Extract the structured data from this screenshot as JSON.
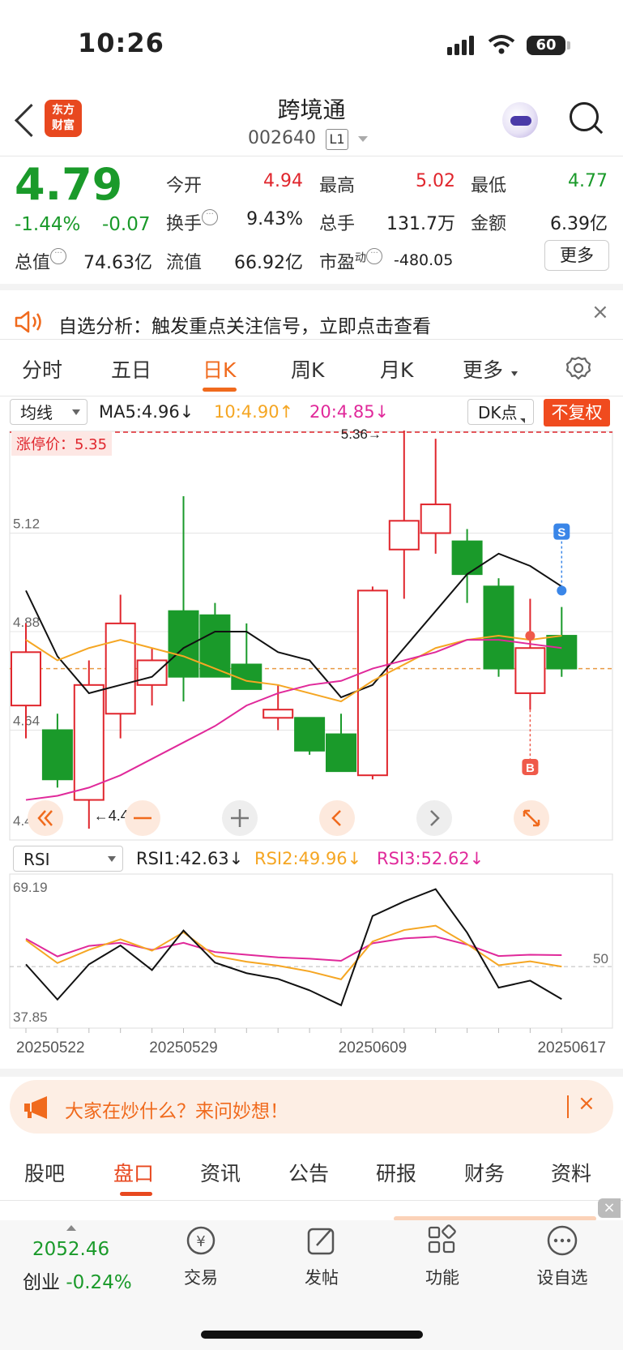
{
  "status": {
    "time": "10:26",
    "battery": "60"
  },
  "header": {
    "logo_line1": "东方",
    "logo_line2": "财富",
    "name": "跨境通",
    "code": "002640",
    "level": "L1"
  },
  "quote": {
    "price": "4.79",
    "change_pct": "-1.44%",
    "change": "-0.07",
    "open_label": "今开",
    "open": "4.94",
    "high_label": "最高",
    "high": "5.02",
    "low_label": "最低",
    "low": "4.77",
    "turnover_label": "换手",
    "turnover": "9.43%",
    "volume_label": "总手",
    "volume": "131.7万",
    "amount_label": "金额",
    "amount": "6.39亿",
    "mktcap_label": "总值",
    "mktcap": "74.63亿",
    "float_label": "流值",
    "float": "66.92亿",
    "pe_label": "市盈",
    "pe_sup": "动",
    "pe": "-480.05",
    "more": "更多"
  },
  "banner": {
    "text": "自选分析：触发重点关注信号，立即点击查看",
    "close": "×"
  },
  "tabs": [
    "分时",
    "五日",
    "日K",
    "周K",
    "月K",
    "更多"
  ],
  "indicators": {
    "ma_select": "均线",
    "ma5": "MA5:4.96↓",
    "ma10": "10:4.90↑",
    "ma20": "20:4.85↓",
    "dk_select": "DK点",
    "adjust": "不复权",
    "limit_up": "涨停价：5.35",
    "rsi_select": "RSI",
    "rsi1": "RSI1:42.63↓",
    "rsi2": "RSI2:49.96↓",
    "rsi3": "RSI3:52.62↓"
  },
  "colors": {
    "up": "#e0262d",
    "down": "#1a9a2a",
    "ma5": "#111111",
    "ma10": "#f5a623",
    "ma20": "#e0299a",
    "accent": "#f06a1d"
  },
  "chart_data": [
    {
      "type": "candlestick",
      "yticks": [
        "5.36",
        "5.12",
        "4.88",
        "4.64",
        "4.40"
      ],
      "ylim": [
        4.4,
        5.36
      ],
      "annotations": {
        "max_label": "5.36→",
        "min_label": "←4.40",
        "sell_marker": "S",
        "buy_marker": "B"
      },
      "candles": [
        {
          "o": 4.7,
          "h": 4.9,
          "l": 4.62,
          "c": 4.83
        },
        {
          "o": 4.64,
          "h": 4.68,
          "l": 4.5,
          "c": 4.52
        },
        {
          "o": 4.47,
          "h": 4.81,
          "l": 4.4,
          "c": 4.75
        },
        {
          "o": 4.68,
          "h": 4.97,
          "l": 4.62,
          "c": 4.9
        },
        {
          "o": 4.75,
          "h": 4.84,
          "l": 4.7,
          "c": 4.81
        },
        {
          "o": 4.93,
          "h": 5.21,
          "l": 4.71,
          "c": 4.77
        },
        {
          "o": 4.92,
          "h": 4.95,
          "l": 4.77,
          "c": 4.77
        },
        {
          "o": 4.8,
          "h": 4.9,
          "l": 4.76,
          "c": 4.74
        },
        {
          "o": 4.67,
          "h": 4.75,
          "l": 4.64,
          "c": 4.69
        },
        {
          "o": 4.67,
          "h": 4.67,
          "l": 4.58,
          "c": 4.59
        },
        {
          "o": 4.63,
          "h": 4.68,
          "l": 4.54,
          "c": 4.54
        },
        {
          "o": 4.53,
          "h": 4.99,
          "l": 4.52,
          "c": 4.98
        },
        {
          "o": 5.08,
          "h": 5.37,
          "l": 4.96,
          "c": 5.15
        },
        {
          "o": 5.12,
          "h": 5.35,
          "l": 5.07,
          "c": 5.19
        },
        {
          "o": 5.1,
          "h": 5.13,
          "l": 4.95,
          "c": 5.02
        },
        {
          "o": 4.99,
          "h": 5.01,
          "l": 4.77,
          "c": 4.79
        },
        {
          "o": 4.73,
          "h": 4.96,
          "l": 4.69,
          "c": 4.84
        },
        {
          "o": 4.87,
          "h": 4.94,
          "l": 4.77,
          "c": 4.79
        }
      ],
      "ma5": [
        4.98,
        4.82,
        4.73,
        4.75,
        4.77,
        4.84,
        4.88,
        4.88,
        4.83,
        4.81,
        4.72,
        4.75,
        4.84,
        4.93,
        5.02,
        5.07,
        5.04,
        4.99
      ],
      "ma10": [
        4.86,
        4.81,
        4.84,
        4.86,
        4.84,
        4.82,
        4.79,
        4.76,
        4.75,
        4.73,
        4.71,
        4.76,
        4.8,
        4.84,
        4.86,
        4.87,
        4.86,
        4.87
      ],
      "ma20": [
        4.47,
        4.48,
        4.5,
        4.53,
        4.57,
        4.61,
        4.65,
        4.7,
        4.73,
        4.75,
        4.76,
        4.79,
        4.81,
        4.83,
        4.86,
        4.86,
        4.85,
        4.84
      ]
    },
    {
      "type": "line",
      "name": "RSI",
      "yticks": [
        "69.19",
        "37.85"
      ],
      "ylim": [
        37.85,
        69.19
      ],
      "ref_label": "50",
      "xticks": [
        "20250522",
        "20250529",
        "20250609",
        "20250617"
      ],
      "rsi1": [
        50.5,
        42.5,
        50.5,
        54.8,
        49.2,
        58.2,
        50.9,
        48.5,
        47.2,
        44.6,
        41.2,
        61.5,
        64.8,
        67.6,
        57.7,
        45.2,
        46.8,
        42.6
      ],
      "rsi2": [
        56.0,
        50.8,
        53.8,
        56.2,
        53.6,
        57.8,
        52.4,
        51.1,
        50.2,
        48.9,
        47.1,
        55.7,
        58.3,
        59.3,
        55.1,
        50.3,
        51.2,
        50.0
      ],
      "rsi3": [
        56.3,
        52.3,
        54.7,
        55.4,
        53.8,
        55.4,
        53.3,
        52.7,
        52.1,
        51.8,
        51.3,
        55.3,
        56.4,
        56.8,
        55.0,
        52.4,
        52.7,
        52.6
      ]
    }
  ],
  "promo": {
    "text": "大家在炒什么？来问妙想！",
    "close": "×"
  },
  "bottom_tabs": [
    "股吧",
    "盘口",
    "资讯",
    "公告",
    "研报",
    "财务",
    "资料"
  ],
  "footer": {
    "index_value": "2052.46",
    "index_name": "创业",
    "index_change": "-0.24%",
    "items": [
      "交易",
      "发帖",
      "功能",
      "设自选"
    ]
  }
}
